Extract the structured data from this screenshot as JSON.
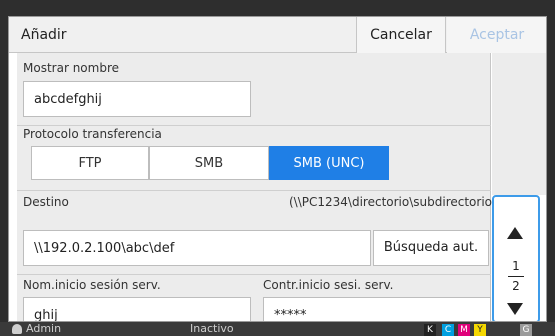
{
  "dialog": {
    "title": "Añadir",
    "cancel_label": "Cancelar",
    "accept_label": "Aceptar"
  },
  "display_name": {
    "label": "Mostrar nombre",
    "value": "abcdefghij"
  },
  "protocol": {
    "label": "Protocolo transferencia",
    "options": [
      "FTP",
      "SMB",
      "SMB (UNC)"
    ],
    "selected": "SMB (UNC)"
  },
  "destination": {
    "label": "Destino",
    "hint": "(\\\\PC1234\\directorio\\subdirectorio)",
    "value": "\\\\192.0.2.100\\abc\\def",
    "search_label": "Búsqueda aut."
  },
  "login": {
    "user_label": "Nom.inicio sesión serv.",
    "user_value": "ghij",
    "password_label": "Contr.inicio sesi. serv.",
    "password_value": "*****"
  },
  "pager": {
    "current": "1",
    "total": "2"
  },
  "status_bar": {
    "user": "Admin",
    "status": "Inactivo",
    "inks": [
      "K",
      "C",
      "M",
      "Y",
      "G"
    ],
    "ink_colors": [
      "#222222",
      "#00a0e0",
      "#e0007a",
      "#f5d800",
      "#9a9a9a"
    ]
  }
}
